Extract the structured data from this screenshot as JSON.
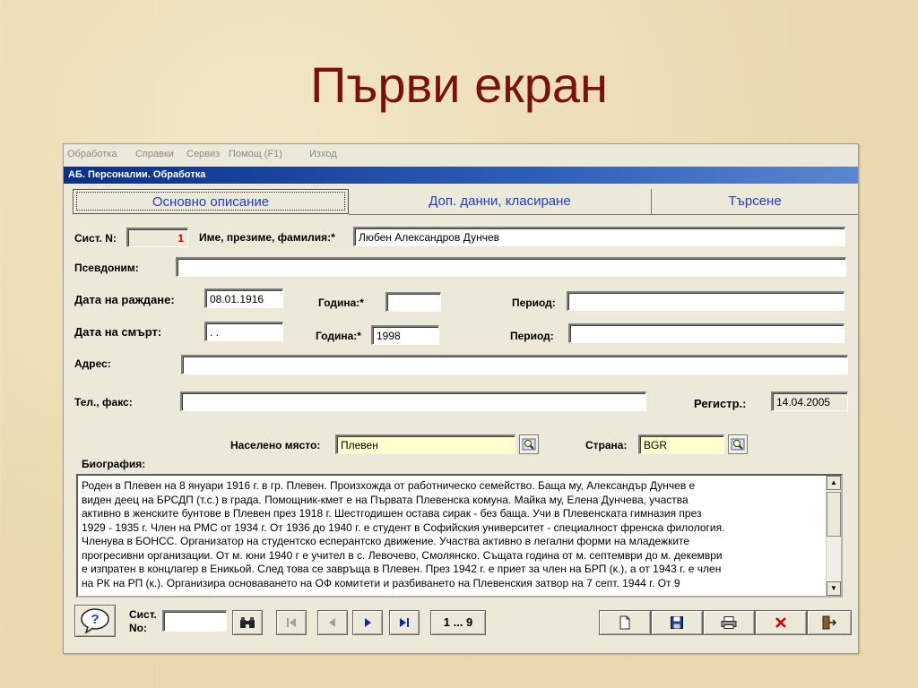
{
  "slide": {
    "title": "Първи екран"
  },
  "menu": {
    "items": [
      "Обработка",
      "Справки",
      "Сервиз",
      "Помощ (F1)",
      "Изход"
    ]
  },
  "window": {
    "title": "АБ. Персоналии. Обработка"
  },
  "tabs": [
    {
      "label": "Основно описание",
      "active": true
    },
    {
      "label": "Доп. данни, класиране",
      "active": false
    },
    {
      "label": "Търсене",
      "active": false
    }
  ],
  "form": {
    "sys_no_label": "Сист. N:",
    "sys_no_value": "1",
    "name_label": "Име, презиме, фамилия:*",
    "name_value": "Любен Александров Дунчев",
    "pseudonym_label": "Псевдоним:",
    "pseudonym_value": "",
    "birth_label": "Дата на раждане:",
    "birth_value": "08.01.1916",
    "birth_year_label": "Година:*",
    "birth_year_value": "",
    "birth_period_label": "Период:",
    "birth_period_value": "",
    "death_label": "Дата на смърт:",
    "death_value": " . .",
    "death_year_label": "Година:*",
    "death_year_value": "1998",
    "death_period_label": "Период:",
    "death_period_value": "",
    "address_label": "Адрес:",
    "address_value": "",
    "phone_label": "Тел., факс:",
    "phone_value": "",
    "reg_label": "Регистр.:",
    "reg_value": "14.04.2005",
    "place_label": "Населено място:",
    "place_value": "Плевен",
    "country_label": "Страна:",
    "country_value": "BGR",
    "bio_label": "Биография:",
    "bio_lines": [
      "Роден в Плевен на 8 януари 1916 г. в гр. Плевен. Произхожда от  работническо семейство. Баща му, Александър Дунчев е",
      "виден деец на БРСДП (т.с.) в града. Помощник-кмет е на Първата Плевенска комуна. Майка му, Елена Дунчева, участва",
      "активно в женските бунтове в Плевен през 1918 г. Шестгодишен остава сирак - без баща. Учи в Плевенската гимназия през",
      "1929 - 1935 г. Член на РМС от 1934 г. От 1936 до 1940 г. е студент в Софийския университет - специалност френска филология.",
      "Членува в БОНСС. Организатор на студентско есперантско движение. Участва активно в легални форми на младежките",
      "прогресивни организации. От м. юни 1940 г е учител в с. Левочево, Смолянско. Същата година от м. септември до м. декември",
      "е изпратен в концлагер в Еникьой. След това се завръща в Плевен. През 1942 г. е приет за член на БРП (к.), а от 1943 г. е член",
      "на РК на РП (к.). Организира основаването на ОФ комитети и разбиването на Плевенския затвор на 7 септ. 1944 г. От 9"
    ]
  },
  "bottom": {
    "help_icon": "question-icon",
    "sys_no_label_1": "Сист.",
    "sys_no_label_2": "No:",
    "sys_no_value": "",
    "record_range": "1 ... 9",
    "nav_icons": [
      "binoculars-icon",
      "first-record-icon",
      "prev-record-icon",
      "next-record-icon",
      "last-record-icon"
    ],
    "action_icons": [
      "new-document-icon",
      "save-icon",
      "print-icon",
      "delete-icon",
      "exit-icon"
    ]
  },
  "colors": {
    "title": "#7a1010",
    "tab_text": "#1e3fbf",
    "titlebar": "#0b2f86",
    "highlight_field": "#ffffcc",
    "sys_no": "#d40000"
  }
}
